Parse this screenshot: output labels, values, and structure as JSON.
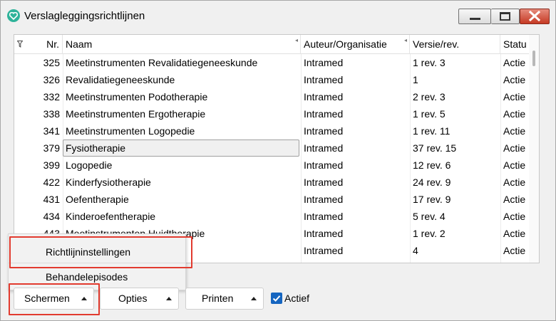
{
  "window": {
    "title": "Verslagleggingsrichtlijnen"
  },
  "grid": {
    "columns": [
      "Nr.",
      "Naam",
      "Auteur/Organisatie",
      "Versie/rev.",
      "Statu"
    ],
    "rows": [
      {
        "nr": "325",
        "naam": "Meetinstrumenten Revalidatiegeneeskunde",
        "auteur": "Intramed",
        "versie": "1 rev. 3",
        "status": "Actie"
      },
      {
        "nr": "326",
        "naam": "Revalidatiegeneeskunde",
        "auteur": "Intramed",
        "versie": "1",
        "status": "Actie"
      },
      {
        "nr": "332",
        "naam": "Meetinstrumenten Podotherapie",
        "auteur": "Intramed",
        "versie": "2 rev. 3",
        "status": "Actie"
      },
      {
        "nr": "338",
        "naam": "Meetinstrumenten Ergotherapie",
        "auteur": "Intramed",
        "versie": "1 rev. 5",
        "status": "Actie"
      },
      {
        "nr": "341",
        "naam": "Meetinstrumenten Logopedie",
        "auteur": "Intramed",
        "versie": "1 rev. 11",
        "status": "Actie"
      },
      {
        "nr": "379",
        "naam": "Fysiotherapie",
        "auteur": "Intramed",
        "versie": "37 rev. 15",
        "status": "Actie"
      },
      {
        "nr": "399",
        "naam": "Logopedie",
        "auteur": "Intramed",
        "versie": "12 rev. 6",
        "status": "Actie"
      },
      {
        "nr": "422",
        "naam": "Kinderfysiotherapie",
        "auteur": "Intramed",
        "versie": "24 rev. 9",
        "status": "Actie"
      },
      {
        "nr": "431",
        "naam": "Oefentherapie",
        "auteur": "Intramed",
        "versie": "17 rev. 9",
        "status": "Actie"
      },
      {
        "nr": "434",
        "naam": "Kinderoefentherapie",
        "auteur": "Intramed",
        "versie": "5 rev. 4",
        "status": "Actie"
      },
      {
        "nr": "443",
        "naam": "Meetinstrumenten Huidtherapie",
        "auteur": "Intramed",
        "versie": "1 rev. 2",
        "status": "Actie"
      },
      {
        "nr": "",
        "naam": "",
        "auteur": "Intramed",
        "versie": "4",
        "status": "Actie"
      }
    ],
    "selected_row": 5
  },
  "popup_menu": {
    "items": [
      "Richtlijninstellingen",
      "Behandelepisodes"
    ]
  },
  "toolbar": {
    "schermen_label": "Schermen",
    "opties_label": "Opties",
    "printen_label": "Printen",
    "actief_label": "Actief",
    "actief_checked": true
  },
  "colors": {
    "accent": "#1565c0",
    "highlight": "#e23b2f",
    "app_icon": "#2fb39a",
    "close": "#c53a24"
  }
}
